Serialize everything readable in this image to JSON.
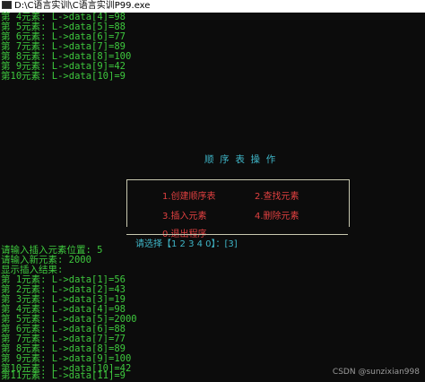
{
  "window": {
    "title": "D:\\C语言实训\\C语言实训P99.exe"
  },
  "output_top": [
    "第 4元素: L->data[4]=98",
    "第 5元素: L->data[5]=88",
    "第 6元素: L->data[6]=77",
    "第 7元素: L->data[7]=89",
    "第 8元素: L->data[8]=100",
    "第 9元素: L->data[9]=42",
    "第10元素: L->data[10]=9"
  ],
  "menu": {
    "title": "顺  序  表  操  作",
    "items": [
      "1.创建顺序表",
      "2.查找元素",
      "3.插入元素",
      "4.删除元素",
      "0.退出程序"
    ],
    "prompt": "请选择【1 2 3 4 0】：[3]"
  },
  "output_bottom": [
    "请输入插入元素位置: 5",
    "请输入新元素: 2000",
    "显示插入结果:",
    "第 1元素: L->data[1]=56",
    "第 2元素: L->data[2]=43",
    "第 3元素: L->data[3]=19",
    "第 4元素: L->data[4]=98",
    "第 5元素: L->data[5]=2000",
    "第 6元素: L->data[6]=88",
    "第 7元素: L->data[7]=77",
    "第 8元素: L->data[8]=89",
    "第 9元素: L->data[9]=100",
    "第10元素: L->data[10]=42",
    "第11元素: L->data[11]=9"
  ],
  "watermark": "CSDN @sunzixian998",
  "colors": {
    "background": "#0c0c0c",
    "output_text": "#3ec83e",
    "menu_title": "#3fb6c8",
    "menu_item": "#e04040",
    "border": "#c8c8b0"
  }
}
